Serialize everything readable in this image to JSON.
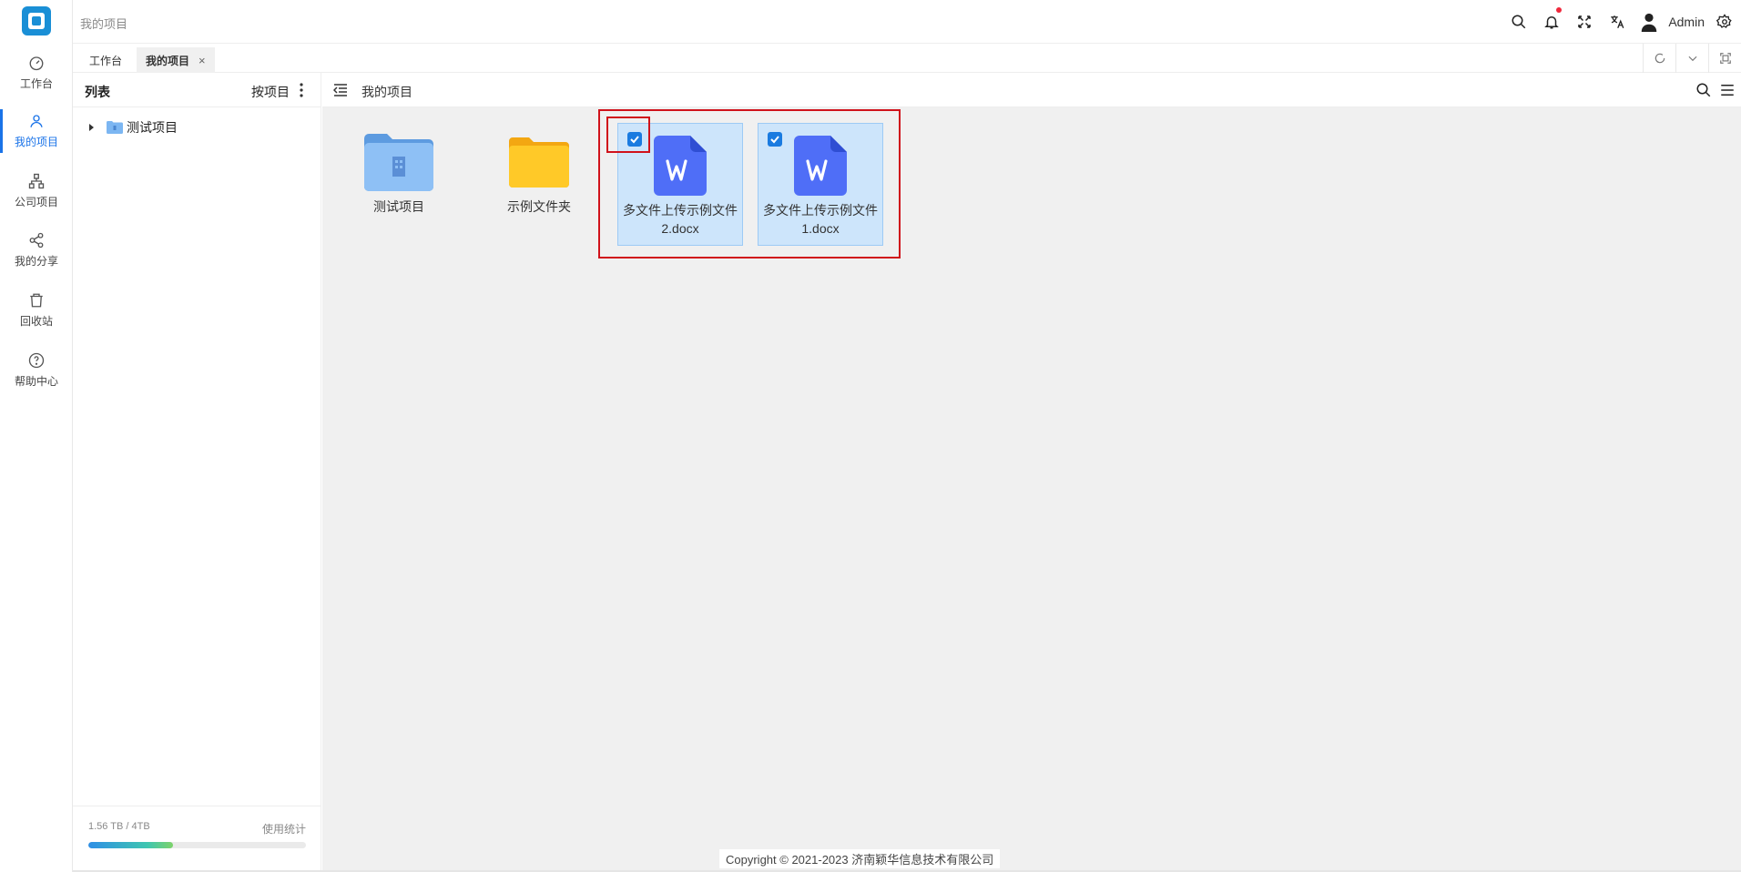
{
  "topbar": {
    "page_title": "我的项目",
    "username": "Admin",
    "icons": [
      "search-icon",
      "bell-icon",
      "fullscreen-icon",
      "translate-icon",
      "user-avatar-icon",
      "settings-icon"
    ]
  },
  "nav": {
    "items": [
      {
        "label": "工作台",
        "icon": "dashboard-icon"
      },
      {
        "label": "我的项目",
        "icon": "user-icon",
        "active": true
      },
      {
        "label": "公司项目",
        "icon": "org-icon"
      },
      {
        "label": "我的分享",
        "icon": "share-icon"
      },
      {
        "label": "回收站",
        "icon": "trash-icon"
      },
      {
        "label": "帮助中心",
        "icon": "help-icon"
      }
    ]
  },
  "tabs": [
    {
      "label": "工作台",
      "active": false
    },
    {
      "label": "我的项目",
      "active": true,
      "close": "×"
    }
  ],
  "tree": {
    "title": "列表",
    "sort_label": "按项目",
    "nodes": [
      {
        "label": "测试项目"
      }
    ]
  },
  "storage": {
    "used_text": "1.56 TB / 4TB",
    "link": "使用统计",
    "fraction": 0.39
  },
  "main": {
    "breadcrumb": "我的项目",
    "files": [
      {
        "name": "测试项目",
        "type": "project-folder",
        "selected": false
      },
      {
        "name": "示例文件夹",
        "type": "folder",
        "selected": false
      },
      {
        "name": "多文件上传示例文件2.docx",
        "type": "word",
        "selected": true
      },
      {
        "name": "多文件上传示例文件1.docx",
        "type": "word",
        "selected": true
      }
    ]
  },
  "footer": {
    "copyright": "Copyright © 2021-2023 济南颖华信息技术有限公司"
  },
  "colors": {
    "accent": "#1a73e8",
    "logo": "#1a8fd6",
    "selection": "#cde5fb",
    "annotation": "#d0121b",
    "word": "#4f6ef7"
  }
}
